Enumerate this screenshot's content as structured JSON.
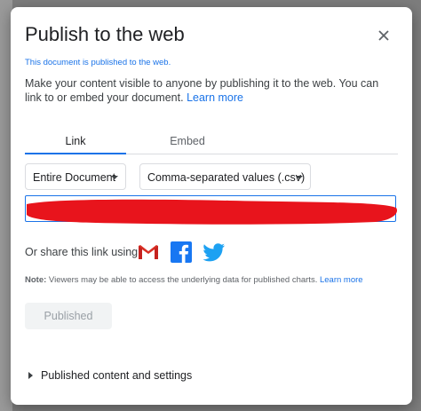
{
  "dialog": {
    "title": "Publish to the web",
    "status": "This document is published to the web.",
    "description": "Make your content visible to anyone by publishing it to the web. You can link to or embed your document.",
    "learn_more": "Learn more"
  },
  "tabs": [
    {
      "label": "Link",
      "active": true
    },
    {
      "label": "Embed",
      "active": false
    }
  ],
  "selects": {
    "scope": "Entire Document",
    "format": "Comma-separated values (.csv)"
  },
  "share": {
    "label": "Or share this link using:",
    "services": [
      "gmail-icon",
      "facebook-icon",
      "twitter-icon"
    ]
  },
  "note": {
    "prefix": "Note:",
    "text": "Viewers may be able to access the underlying data for published charts.",
    "link": "Learn more"
  },
  "published_button": "Published",
  "settings_label": "Published content and settings",
  "colors": {
    "accent": "#1a73e8",
    "redaction": "#e8141c",
    "gmail_red": "#d93025",
    "facebook": "#1877f2",
    "twitter": "#1da1f2"
  }
}
